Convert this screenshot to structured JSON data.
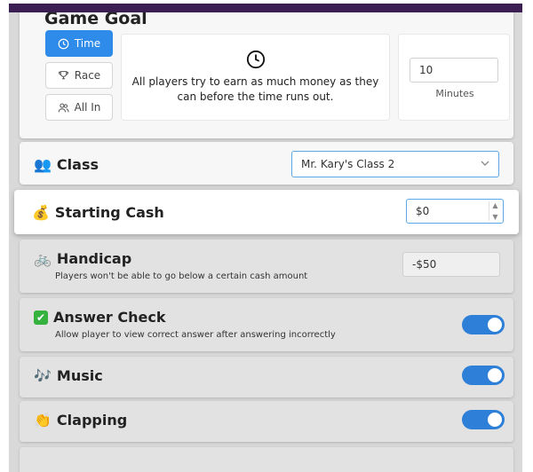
{
  "game_goal": {
    "title": "Game Goal",
    "modes": [
      {
        "label": "Time",
        "icon": "clock-icon",
        "selected": true
      },
      {
        "label": "Race",
        "icon": "trophy-icon",
        "selected": false
      },
      {
        "label": "All In",
        "icon": "users-icon",
        "selected": false
      }
    ],
    "description_line1": "All players try to earn as much money as they",
    "description_line2": "can before the time runs out.",
    "minutes_value": "10",
    "minutes_label": "Minutes"
  },
  "class_row": {
    "label": "Class",
    "icon": "👥",
    "selected": "Mr. Kary's Class 2"
  },
  "starting_cash": {
    "label": "Starting Cash",
    "icon": "💰",
    "value": "$0"
  },
  "handicap": {
    "label": "Handicap",
    "icon": "🚲",
    "subtitle": "Players won't be able to go below a certain cash amount",
    "value": "-$50"
  },
  "answer_check": {
    "label": "Answer Check",
    "icon": "✔",
    "subtitle": "Allow player to view correct answer after answering incorrectly",
    "enabled": true
  },
  "music": {
    "label": "Music",
    "icon": "🎶",
    "enabled": true
  },
  "clapping": {
    "label": "Clapping",
    "icon": "👏",
    "enabled": true
  },
  "colors": {
    "accent": "#2e8bea",
    "toggle_on": "#2e7fd8",
    "header_bar": "#3b1f52"
  }
}
